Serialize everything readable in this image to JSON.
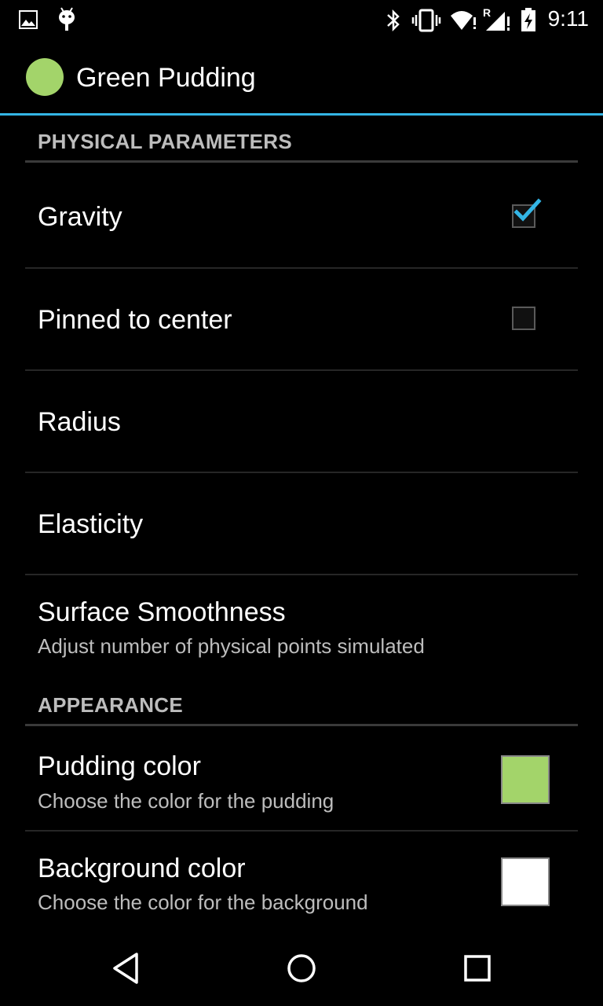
{
  "status_bar": {
    "time": "9:11",
    "left_icons": [
      "image-notification-icon",
      "android-notification-icon"
    ],
    "right_icons": [
      "bluetooth-icon",
      "vibrate-icon",
      "wifi-icon",
      "signal-roaming-icon",
      "battery-charging-icon"
    ],
    "roaming_indicator": "R"
  },
  "app_bar": {
    "title": "Green Pudding",
    "logo_color": "#a3d46a",
    "accent_color": "#33b5e5"
  },
  "sections": {
    "physical": {
      "header": "PHYSICAL PARAMETERS",
      "gravity": {
        "title": "Gravity",
        "checked": true
      },
      "pinned": {
        "title": "Pinned to center",
        "checked": false
      },
      "radius": {
        "title": "Radius"
      },
      "elasticity": {
        "title": "Elasticity"
      },
      "smoothness": {
        "title": "Surface Smoothness",
        "summary": "Adjust number of physical points simulated"
      }
    },
    "appearance": {
      "header": "APPEARANCE",
      "pudding_color": {
        "title": "Pudding color",
        "summary": "Choose the color for the pudding",
        "color": "#a3d46a"
      },
      "background_color": {
        "title": "Background color",
        "summary": "Choose the color for the background",
        "color": "#ffffff"
      }
    }
  },
  "nav_bar": {
    "buttons": [
      "back-icon",
      "home-icon",
      "recents-icon"
    ]
  }
}
